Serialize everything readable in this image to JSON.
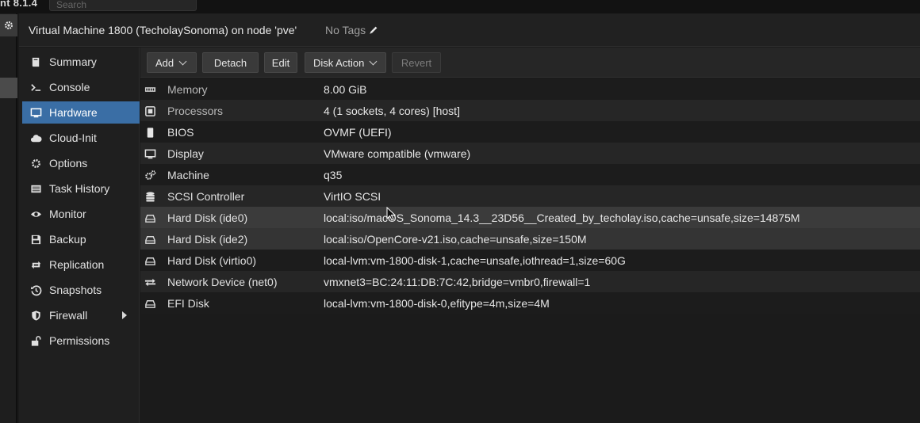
{
  "topbar": {
    "version": "nt 8.1.4",
    "search_placeholder": "Search"
  },
  "header": {
    "title": "Virtual Machine 1800 (TecholaySonoma) on node 'pve'",
    "tags": "No Tags"
  },
  "nav": {
    "items": [
      {
        "label": "Summary",
        "icon": "book-icon"
      },
      {
        "label": "Console",
        "icon": "terminal-icon"
      },
      {
        "label": "Hardware",
        "icon": "desktop-icon",
        "active": true
      },
      {
        "label": "Cloud-Init",
        "icon": "cloud-icon"
      },
      {
        "label": "Options",
        "icon": "gear-icon"
      },
      {
        "label": "Task History",
        "icon": "list-icon"
      },
      {
        "label": "Monitor",
        "icon": "eye-icon"
      },
      {
        "label": "Backup",
        "icon": "floppy-icon"
      },
      {
        "label": "Replication",
        "icon": "retweet-icon"
      },
      {
        "label": "Snapshots",
        "icon": "history-icon"
      },
      {
        "label": "Firewall",
        "icon": "shield-icon"
      },
      {
        "label": "Permissions",
        "icon": "unlock-icon"
      }
    ]
  },
  "toolbar": {
    "add": "Add",
    "detach": "Detach",
    "edit": "Edit",
    "disk_action": "Disk Action",
    "revert": "Revert"
  },
  "hardware": [
    {
      "name": "Memory",
      "value": "8.00 GiB",
      "icon": "memory-icon"
    },
    {
      "name": "Processors",
      "value": "4 (1 sockets, 4 cores) [host]",
      "icon": "cpu-icon"
    },
    {
      "name": "BIOS",
      "value": "OVMF (UEFI)",
      "icon": "microchip-icon"
    },
    {
      "name": "Display",
      "value": "VMware compatible (vmware)",
      "icon": "monitor-icon"
    },
    {
      "name": "Machine",
      "value": "q35",
      "icon": "cogs-icon"
    },
    {
      "name": "SCSI Controller",
      "value": "VirtIO SCSI",
      "icon": "database-icon"
    },
    {
      "name": "Hard Disk (ide0)",
      "value": "local:iso/macOS_Sonoma_14.3__23D56__Created_by_techolay.iso,cache=unsafe,size=14875M",
      "icon": "hdd-icon"
    },
    {
      "name": "Hard Disk (ide2)",
      "value": "local:iso/OpenCore-v21.iso,cache=unsafe,size=150M",
      "icon": "hdd-icon"
    },
    {
      "name": "Hard Disk (virtio0)",
      "value": "local-lvm:vm-1800-disk-1,cache=unsafe,iothread=1,size=60G",
      "icon": "hdd-icon"
    },
    {
      "name": "Network Device (net0)",
      "value": "vmxnet3=BC:24:11:DB:7C:42,bridge=vmbr0,firewall=1",
      "icon": "exchange-icon"
    },
    {
      "name": "EFI Disk",
      "value": "local-lvm:vm-1800-disk-0,efitype=4m,size=4M",
      "icon": "hdd-icon"
    }
  ]
}
